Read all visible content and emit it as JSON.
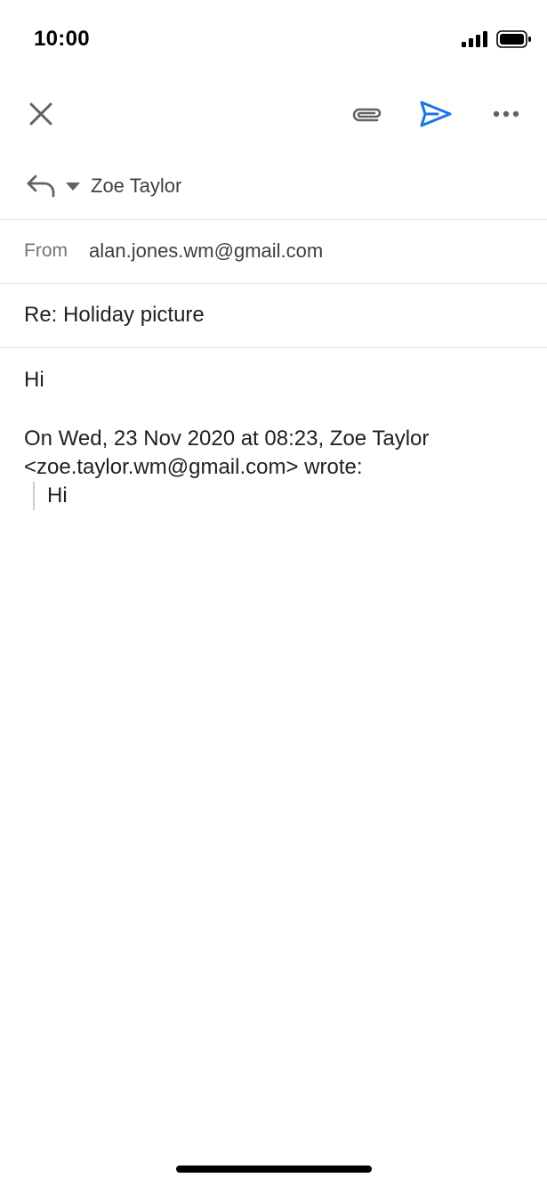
{
  "status_bar": {
    "time": "10:00"
  },
  "toolbar": {
    "close_icon": "close-icon",
    "attach_icon": "paperclip-icon",
    "send_icon": "send-icon",
    "more_icon": "more-horizontal-icon",
    "send_color": "#1a73e8"
  },
  "reply": {
    "recipient": "Zoe Taylor"
  },
  "from": {
    "label": "From",
    "address": "alan.jones.wm@gmail.com"
  },
  "subject": {
    "value": "Re: Holiday picture"
  },
  "body": {
    "greeting": "Hi",
    "quote_header_line1": "On Wed, 23 Nov 2020 at 08:23, Zoe Taylor",
    "quote_header_line2": "<zoe.taylor.wm@gmail.com> wrote:",
    "quoted_text": "Hi"
  }
}
